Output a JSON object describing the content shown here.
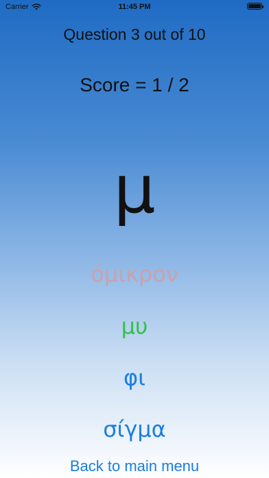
{
  "status_bar": {
    "carrier": "Carrier",
    "time": "11:45 PM",
    "wifi_icon": "wifi-icon",
    "battery_icon": "battery-icon"
  },
  "quiz": {
    "question_text": "Question 3 out of 10",
    "score_text": "Score = 1 / 2",
    "letter": "μ",
    "answers": [
      {
        "label": "όμικρον",
        "color": "#c9a2ae"
      },
      {
        "label": "μυ",
        "color": "#34c04a"
      },
      {
        "label": "φι",
        "color": "#1a7ee0"
      },
      {
        "label": "σίγμα",
        "color": "#1a7ee0"
      }
    ],
    "back_label": "Back to main menu"
  },
  "colors": {
    "background_top": "#1f6bc4",
    "background_bottom": "#ffffff",
    "link": "#1a7ee0"
  }
}
